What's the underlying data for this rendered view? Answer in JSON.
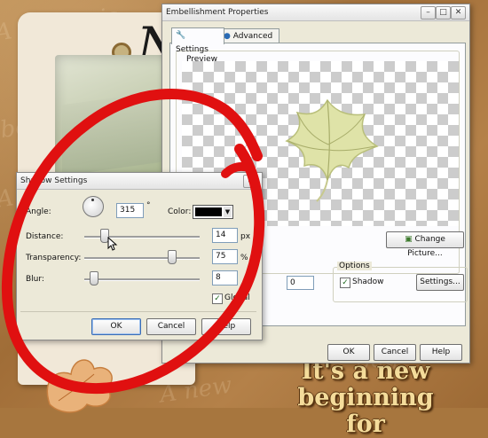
{
  "background": {
    "script_words": [
      "A Nemesis",
      "beginning",
      "A new",
      "beginning",
      "A new",
      "beginning",
      "A new",
      "beginning",
      "A new"
    ],
    "tag_letter": "N",
    "overlay_lines": [
      "It's a new",
      "beginning for"
    ]
  },
  "embellishment_dialog": {
    "title": "Embellishment Properties",
    "title_buttons": {
      "help": "?",
      "close": "✕"
    },
    "tabs": [
      {
        "label": "Settings",
        "icon": "wrench-icon",
        "active": true
      },
      {
        "label": "Advanced",
        "icon": "globe-icon",
        "active": false
      }
    ],
    "preview_label": "Preview",
    "change_picture_label": "Change Picture...",
    "size_value": "0",
    "options_label": "Options",
    "shadow_checkbox": {
      "label": "Shadow",
      "checked": true
    },
    "settings_button": "Settings...",
    "ok": "OK",
    "cancel": "Cancel",
    "help": "Help"
  },
  "shadow_dialog": {
    "title": "Shadow Settings",
    "close": "✕",
    "angle": {
      "label": "Angle:",
      "value": "315",
      "unit": "°"
    },
    "color": {
      "label": "Color:",
      "value": "#000000"
    },
    "distance": {
      "label": "Distance:",
      "value": "14",
      "unit": "px",
      "slider_fraction": 0.17
    },
    "transparency": {
      "label": "Transparency:",
      "value": "75",
      "unit": "%",
      "slider_fraction": 0.75
    },
    "blur": {
      "label": "Blur:",
      "value": "8",
      "slider_fraction": 0.08
    },
    "global_checkbox": {
      "label": "Global",
      "checked": true
    },
    "ok": "OK",
    "cancel": "Cancel",
    "help": "Help"
  },
  "colors": {
    "highlight_ring": "#e01010",
    "dialog_face": "#ece9d8",
    "leaf": "#dfe3a8"
  }
}
